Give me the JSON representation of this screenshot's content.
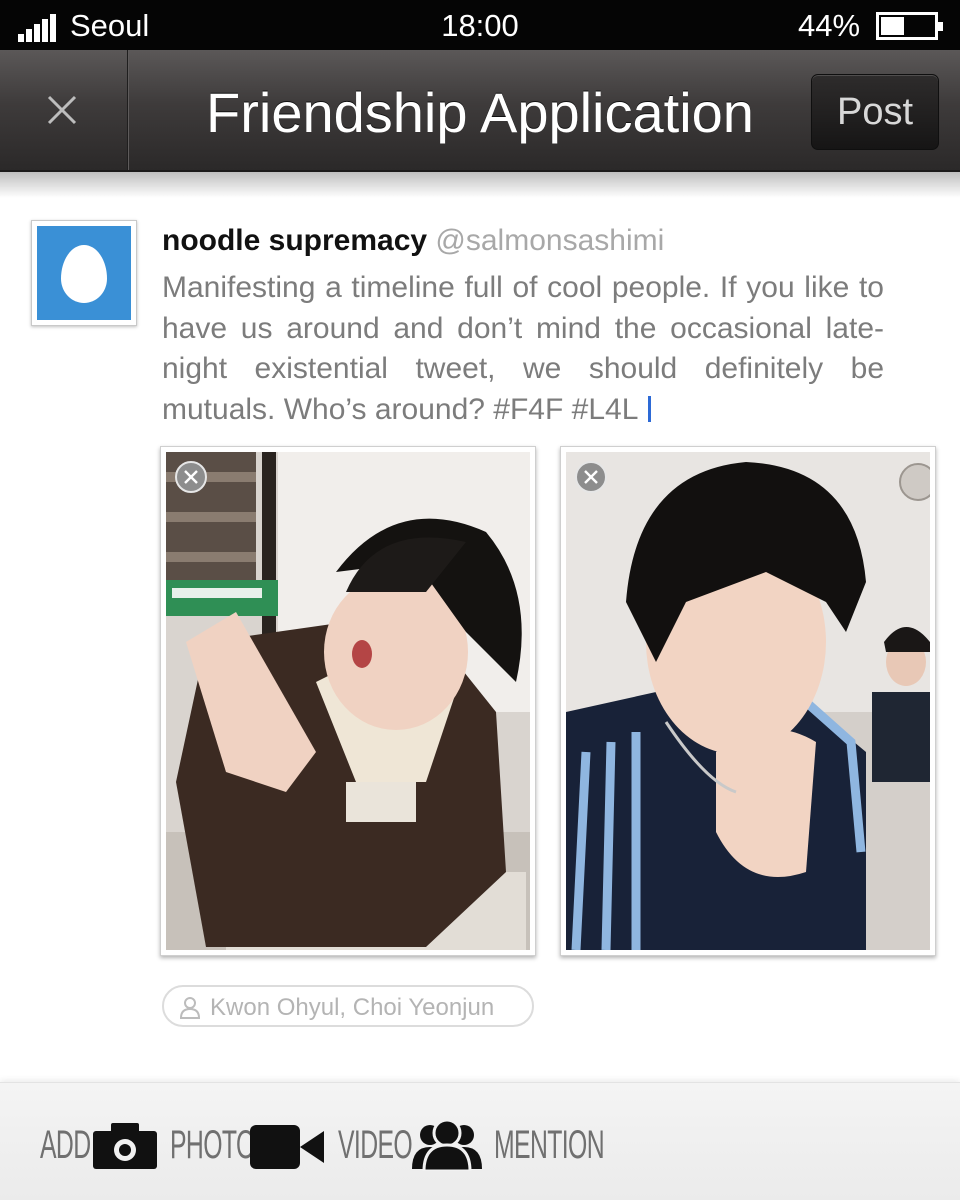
{
  "status_bar": {
    "carrier": "Seoul",
    "time": "18:00",
    "battery_percent": "44%",
    "battery_level": 0.44
  },
  "nav": {
    "title": "Friendship Application",
    "close_icon": "close-icon",
    "post_label": "Post"
  },
  "tweet": {
    "display_name": "noodle supremacy",
    "handle": "@salmonsashimi",
    "text": "Manifesting a timeline full of cool people. If you like to have us around and don’t mind the occasional late-night existential tweet, we should definitely be mutuals. Who’s around? #F4F #L4L"
  },
  "photos": [
    {
      "name": "attached-photo-1",
      "remove_icon": "remove-icon"
    },
    {
      "name": "attached-photo-2",
      "remove_icon": "remove-icon"
    }
  ],
  "tagged_people": "Kwon Ohyul, Choi Yeonjun",
  "toolbar": {
    "add_label": "ADD",
    "photo_label": "PHOTO",
    "video_label": "VIDEO",
    "mention_label": "MENTION",
    "icons": [
      "camera-icon",
      "video-camera-icon",
      "people-icon"
    ]
  },
  "colors": {
    "accent": "#3a90d6",
    "caret": "#2d6ad6",
    "nav_bg": "#3e3b3b"
  }
}
